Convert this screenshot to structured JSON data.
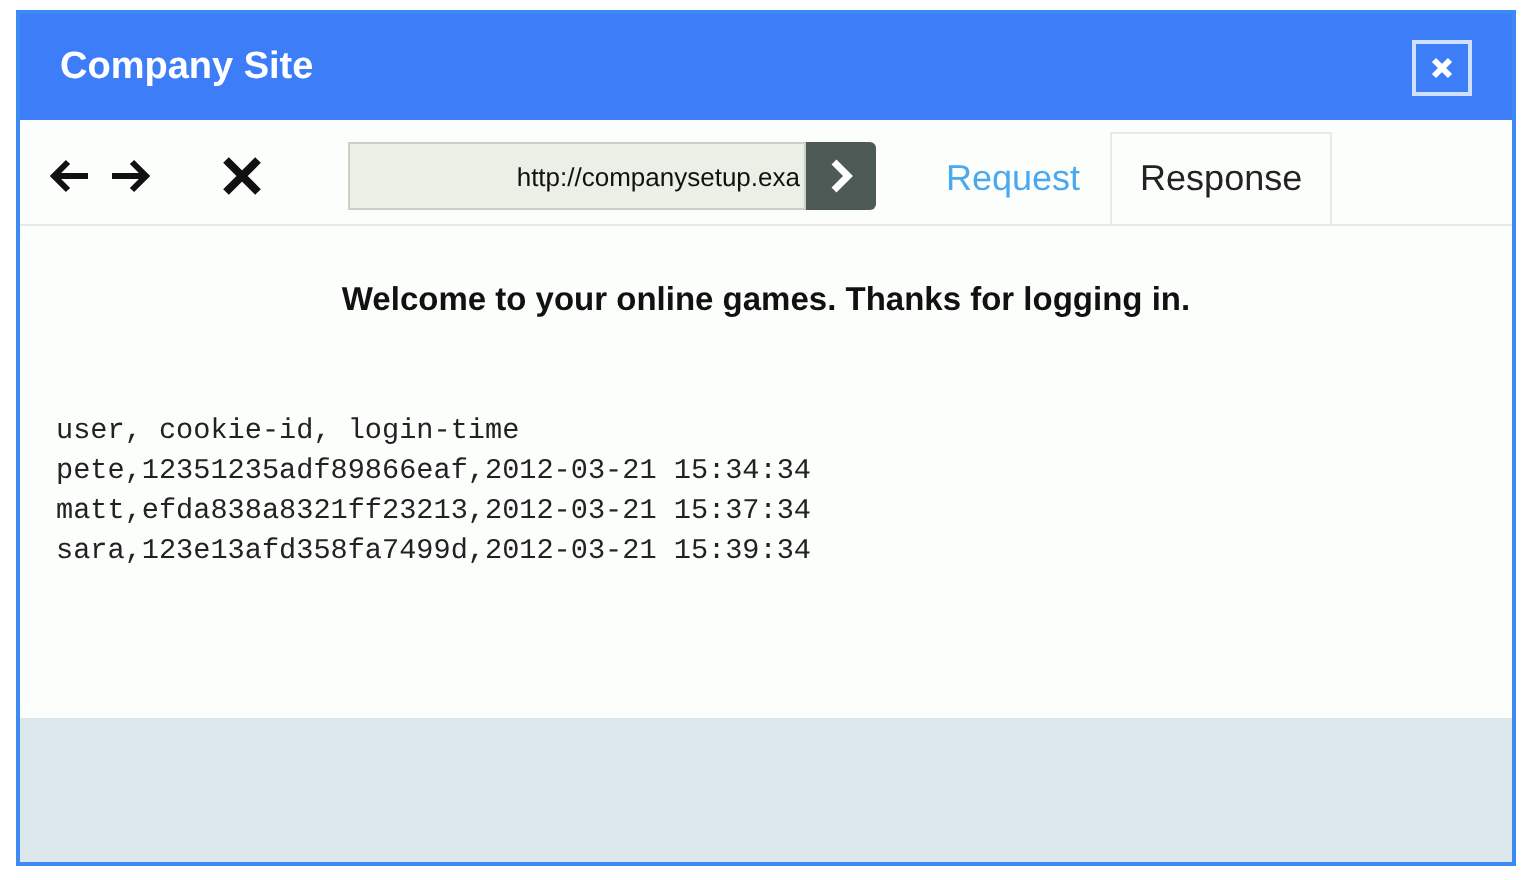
{
  "window": {
    "title": "Company Site"
  },
  "toolbar": {
    "address": "http://companysetup.exa"
  },
  "tabs": [
    {
      "label": "Request",
      "selected": false
    },
    {
      "label": "Response",
      "selected": true
    }
  ],
  "content": {
    "heading": "Welcome to your online games. Thanks for logging in.",
    "lines": [
      "user, cookie-id, login-time",
      "pete,12351235adf89866eaf,2012-03-21 15:34:34",
      "matt,efda838a8321ff23213,2012-03-21 15:37:34",
      "sara,123e13afd358fa7499d,2012-03-21 15:39:34"
    ]
  }
}
